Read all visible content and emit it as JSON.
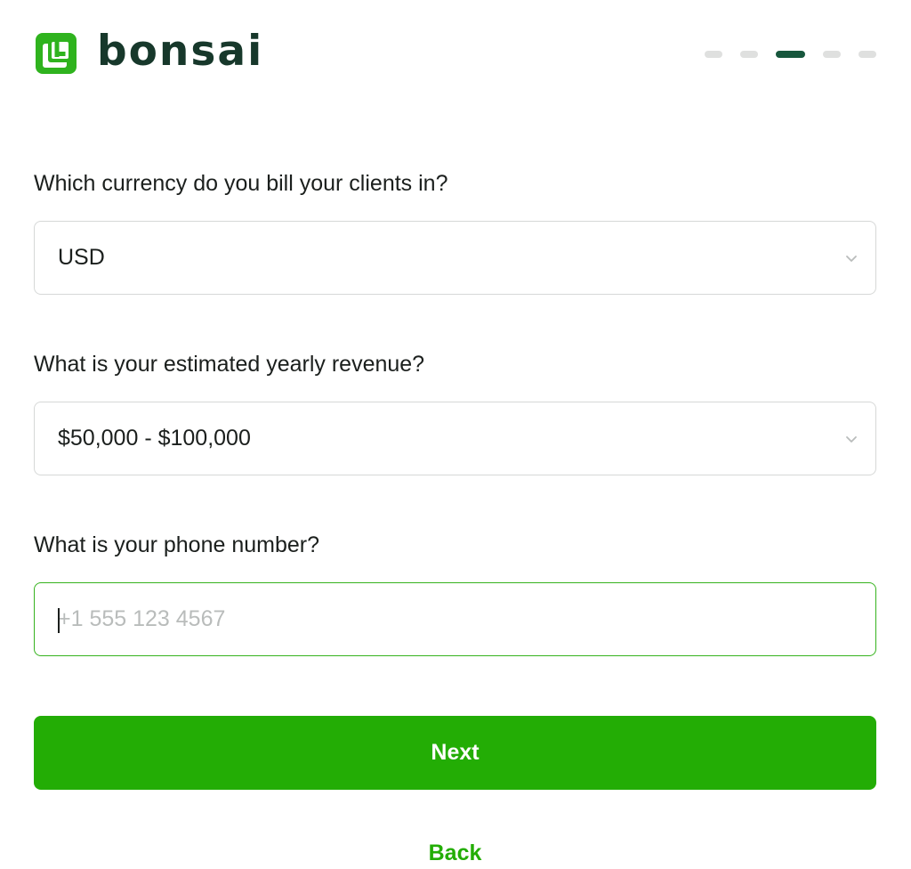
{
  "brand": {
    "name": "bonsai",
    "logo_icon": "bonsai-logo-icon",
    "color": "#2fb31e"
  },
  "progress": {
    "total_steps": 5,
    "current_step": 3,
    "active_color": "#17573d",
    "inactive_color": "#dfe0df"
  },
  "form": {
    "currency": {
      "question": "Which currency do you bill your clients in?",
      "value": "USD",
      "icon": "chevron-down-icon"
    },
    "revenue": {
      "question": "What is your estimated yearly revenue?",
      "value": "$50,000 - $100,000",
      "icon": "chevron-down-icon"
    },
    "phone": {
      "question": "What is your phone number?",
      "value": "",
      "placeholder": "+1 555 123 4567"
    }
  },
  "actions": {
    "next_label": "Next",
    "back_label": "Back",
    "accent": "#23ad05"
  }
}
